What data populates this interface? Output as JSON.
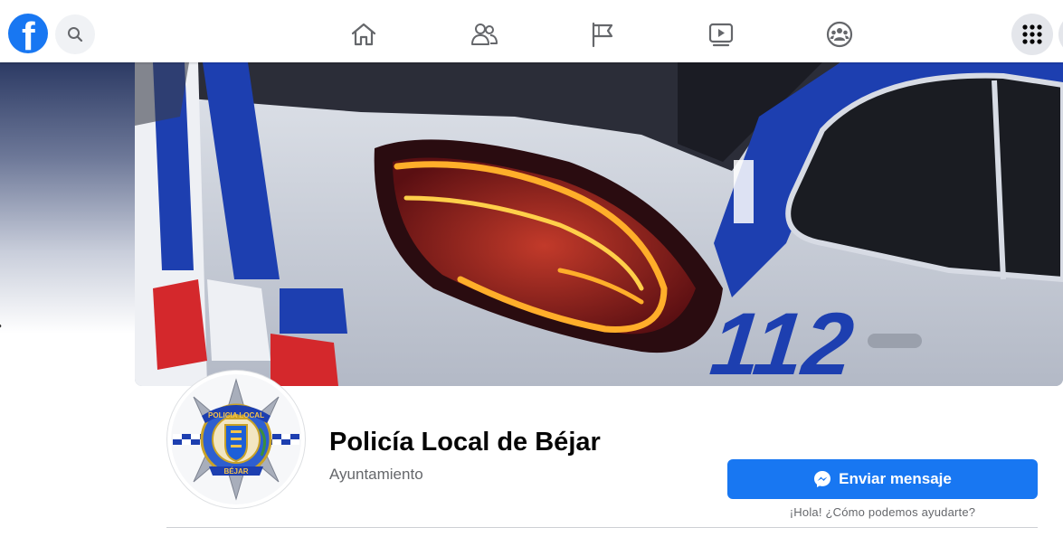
{
  "topbar": {
    "logo_letter": "f",
    "icons": [
      "facebook-logo",
      "search-icon",
      "home-icon",
      "friends-icon",
      "pages-flag-icon",
      "watch-icon",
      "groups-icon",
      "menu-grid-icon"
    ]
  },
  "cover": {
    "plate_number": "112"
  },
  "avatar": {
    "badge_top_text": "POLICIA LOCAL",
    "badge_bottom_text": "BÉJAR"
  },
  "page": {
    "name": "Policía Local de Béjar",
    "category": "Ayuntamiento"
  },
  "actions": {
    "message_button": "Enviar mensaje",
    "greeting": "¡Hola! ¿Cómo podemos ayudarte?"
  },
  "colors": {
    "brand": "#1877f2",
    "secondary_text": "#65676b",
    "police_blue": "#1d3fb0",
    "police_red": "#d4282c"
  }
}
